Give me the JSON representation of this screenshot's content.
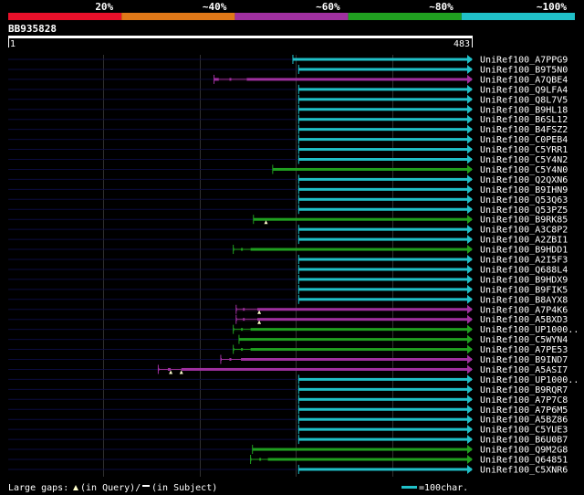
{
  "query": {
    "name": "BB935828",
    "start": "1",
    "end": "483",
    "length": 483
  },
  "identity_legend": [
    {
      "label": "20%",
      "color": "#e8102a"
    },
    {
      "label": "~40%",
      "color": "#e07818"
    },
    {
      "label": "~60%",
      "color": "#a030a0"
    },
    {
      "label": "~80%",
      "color": "#20a020"
    },
    {
      "label": "~100%",
      "color": "#20c0c8"
    }
  ],
  "footer": {
    "large_gaps_label": "Large gaps:",
    "in_query": "(in Query)/",
    "in_subject": "(in Subject)",
    "scale_label": "=100char."
  },
  "chart_data": {
    "type": "alignment",
    "x_range": [
      1,
      483
    ],
    "series": [
      {
        "name": "UniRef100_A7PPG9",
        "start": 297,
        "end": 483,
        "color": "#20c0c8",
        "gaps": []
      },
      {
        "name": "UniRef100_B9T5N0",
        "start": 303,
        "end": 483,
        "color": "#20c0c8",
        "gaps": []
      },
      {
        "name": "UniRef100_A7QBE4",
        "start": 215,
        "end": 483,
        "color": "#a030a0",
        "gaps": [
          [
            220,
            231
          ],
          [
            233,
            249
          ]
        ]
      },
      {
        "name": "UniRef100_Q9LFA4",
        "start": 303,
        "end": 483,
        "color": "#20c0c8",
        "gaps": []
      },
      {
        "name": "UniRef100_Q8L7V5",
        "start": 303,
        "end": 483,
        "color": "#20c0c8",
        "gaps": []
      },
      {
        "name": "UniRef100_B9HL18",
        "start": 303,
        "end": 483,
        "color": "#20c0c8",
        "gaps": []
      },
      {
        "name": "UniRef100_B6SL12",
        "start": 303,
        "end": 483,
        "color": "#20c0c8",
        "gaps": []
      },
      {
        "name": "UniRef100_B4FSZ2",
        "start": 303,
        "end": 483,
        "color": "#20c0c8",
        "gaps": []
      },
      {
        "name": "UniRef100_C0PEB4",
        "start": 303,
        "end": 483,
        "color": "#20c0c8",
        "gaps": []
      },
      {
        "name": "UniRef100_C5YRR1",
        "start": 303,
        "end": 483,
        "color": "#20c0c8",
        "gaps": []
      },
      {
        "name": "UniRef100_C5Y4N2",
        "start": 303,
        "end": 483,
        "color": "#20c0c8",
        "gaps": []
      },
      {
        "name": "UniRef100_C5Y4N0",
        "start": 276,
        "end": 483,
        "color": "#20a020",
        "gaps": []
      },
      {
        "name": "UniRef100_Q2QXN6",
        "start": 303,
        "end": 483,
        "color": "#20c0c8",
        "gaps": []
      },
      {
        "name": "UniRef100_B9IHN9",
        "start": 303,
        "end": 483,
        "color": "#20c0c8",
        "gaps": []
      },
      {
        "name": "UniRef100_Q53Q63",
        "start": 303,
        "end": 483,
        "color": "#20c0c8",
        "gaps": []
      },
      {
        "name": "UniRef100_Q53PZ5",
        "start": 303,
        "end": 483,
        "color": "#20c0c8",
        "gaps": []
      },
      {
        "name": "UniRef100_B9RK85",
        "start": 256,
        "end": 483,
        "color": "#20a020",
        "gaps": [],
        "query_gaps": [
          269
        ]
      },
      {
        "name": "UniRef100_A3C8P2",
        "start": 303,
        "end": 483,
        "color": "#20c0c8",
        "gaps": []
      },
      {
        "name": "UniRef100_A2ZBI1",
        "start": 303,
        "end": 483,
        "color": "#20c0c8",
        "gaps": []
      },
      {
        "name": "UniRef100_B9HDD1",
        "start": 235,
        "end": 483,
        "color": "#20a020",
        "gaps": [
          [
            236,
            243
          ],
          [
            245,
            253
          ]
        ]
      },
      {
        "name": "UniRef100_A2I5F3",
        "start": 303,
        "end": 483,
        "color": "#20c0c8",
        "gaps": []
      },
      {
        "name": "UniRef100_Q688L4",
        "start": 303,
        "end": 483,
        "color": "#20c0c8",
        "gaps": []
      },
      {
        "name": "UniRef100_B9HDX9",
        "start": 303,
        "end": 483,
        "color": "#20c0c8",
        "gaps": []
      },
      {
        "name": "UniRef100_B9FIK5",
        "start": 303,
        "end": 483,
        "color": "#20c0c8",
        "gaps": []
      },
      {
        "name": "UniRef100_B8AYX8",
        "start": 303,
        "end": 483,
        "color": "#20c0c8",
        "gaps": []
      },
      {
        "name": "UniRef100_A7P4K6",
        "start": 238,
        "end": 483,
        "color": "#a030a0",
        "gaps": [
          [
            239,
            245
          ],
          [
            247,
            260
          ]
        ],
        "query_gaps": [
          262
        ]
      },
      {
        "name": "UniRef100_A5BXD3",
        "start": 238,
        "end": 483,
        "color": "#a030a0",
        "gaps": [
          [
            239,
            245
          ],
          [
            247,
            260
          ]
        ],
        "query_gaps": [
          262
        ]
      },
      {
        "name": "UniRef100_UP1000..",
        "start": 235,
        "end": 483,
        "color": "#20a020",
        "gaps": [
          [
            236,
            243
          ],
          [
            245,
            253
          ]
        ]
      },
      {
        "name": "UniRef100_C5WYN4",
        "start": 241,
        "end": 483,
        "color": "#20a020",
        "gaps": []
      },
      {
        "name": "UniRef100_A7PE53",
        "start": 235,
        "end": 483,
        "color": "#20a020",
        "gaps": [
          [
            236,
            243
          ],
          [
            245,
            253
          ]
        ]
      },
      {
        "name": "UniRef100_B9IND7",
        "start": 222,
        "end": 483,
        "color": "#a030a0",
        "gaps": [
          [
            223,
            231
          ],
          [
            233,
            243
          ]
        ]
      },
      {
        "name": "UniRef100_A5ASI7",
        "start": 157,
        "end": 483,
        "color": "#a030a0",
        "gaps": [
          [
            158,
            167
          ],
          [
            170,
            181
          ]
        ],
        "query_gaps": [
          170,
          181
        ]
      },
      {
        "name": "UniRef100_UP1000..",
        "start": 303,
        "end": 483,
        "color": "#20c0c8",
        "gaps": []
      },
      {
        "name": "UniRef100_B9RQR7",
        "start": 303,
        "end": 483,
        "color": "#20c0c8",
        "gaps": []
      },
      {
        "name": "UniRef100_A7P7C8",
        "start": 303,
        "end": 483,
        "color": "#20c0c8",
        "gaps": []
      },
      {
        "name": "UniRef100_A7P6M5",
        "start": 303,
        "end": 483,
        "color": "#20c0c8",
        "gaps": []
      },
      {
        "name": "UniRef100_A5BZ86",
        "start": 303,
        "end": 483,
        "color": "#20c0c8",
        "gaps": []
      },
      {
        "name": "UniRef100_C5YUE3",
        "start": 303,
        "end": 483,
        "color": "#20c0c8",
        "gaps": []
      },
      {
        "name": "UniRef100_B6U0B7",
        "start": 303,
        "end": 483,
        "color": "#20c0c8",
        "gaps": []
      },
      {
        "name": "UniRef100_Q9M2G8",
        "start": 255,
        "end": 483,
        "color": "#20a020",
        "gaps": []
      },
      {
        "name": "UniRef100_Q64851",
        "start": 253,
        "end": 483,
        "color": "#20a020",
        "gaps": [
          [
            254,
            262
          ],
          [
            264,
            271
          ]
        ]
      },
      {
        "name": "UniRef100_C5XNR6",
        "start": 303,
        "end": 483,
        "color": "#20c0c8",
        "gaps": []
      }
    ]
  }
}
